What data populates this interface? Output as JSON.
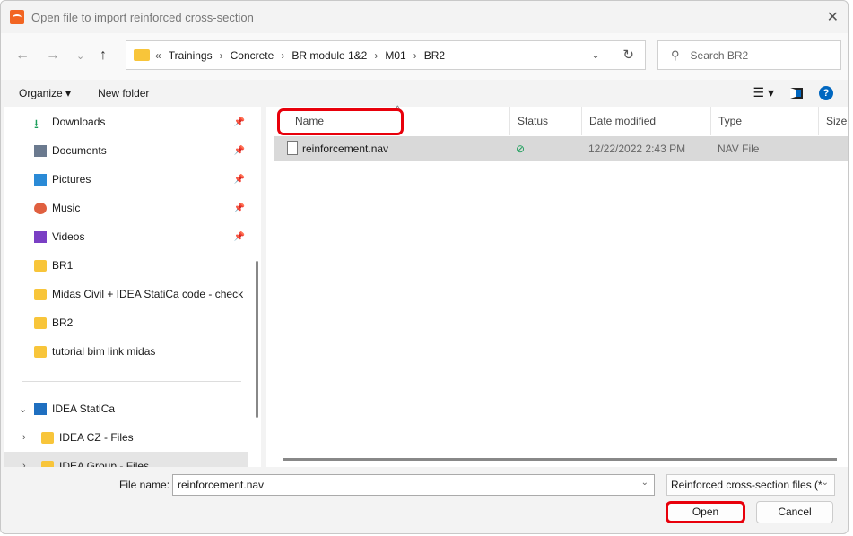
{
  "title": "Open file to import reinforced cross-section",
  "address": {
    "crumbs": [
      "Trainings",
      "Concrete",
      "BR module 1&2",
      "M01",
      "BR2"
    ]
  },
  "search": {
    "placeholder": "Search BR2"
  },
  "toolbar": {
    "organize": "Organize ▾",
    "new_folder": "New folder"
  },
  "sidebar": {
    "items": [
      {
        "label": "Downloads",
        "icon": "download-icon",
        "pinned": true
      },
      {
        "label": "Documents",
        "icon": "documents-icon",
        "pinned": true
      },
      {
        "label": "Pictures",
        "icon": "pictures-icon",
        "pinned": true
      },
      {
        "label": "Music",
        "icon": "music-icon",
        "pinned": true
      },
      {
        "label": "Videos",
        "icon": "videos-icon",
        "pinned": true
      },
      {
        "label": "BR1",
        "icon": "folder-icon"
      },
      {
        "label": "Midas Civil + IDEA StatiCa code - check",
        "icon": "folder-icon"
      },
      {
        "label": "BR2",
        "icon": "folder-icon"
      },
      {
        "label": "tutorial bim link midas",
        "icon": "folder-icon"
      },
      {
        "label": "IDEA StatiCa",
        "icon": "building-icon"
      },
      {
        "label": "IDEA CZ - Files",
        "icon": "folder-icon"
      },
      {
        "label": "IDEA Group - Files",
        "icon": "folder-icon"
      }
    ]
  },
  "columns": [
    "Name",
    "Status",
    "Date modified",
    "Type",
    "Size"
  ],
  "files": [
    {
      "name": "reinforcement.nav",
      "status": "synced",
      "date": "12/22/2022 2:43 PM",
      "type": "NAV File"
    }
  ],
  "bottom": {
    "file_name_label": "File name:",
    "file_name_value": "reinforcement.nav",
    "file_type": "Reinforced cross-section files (*",
    "open": "Open",
    "cancel": "Cancel"
  },
  "colors": {
    "highlight": "#e8000b",
    "accent": "#0067c0"
  }
}
